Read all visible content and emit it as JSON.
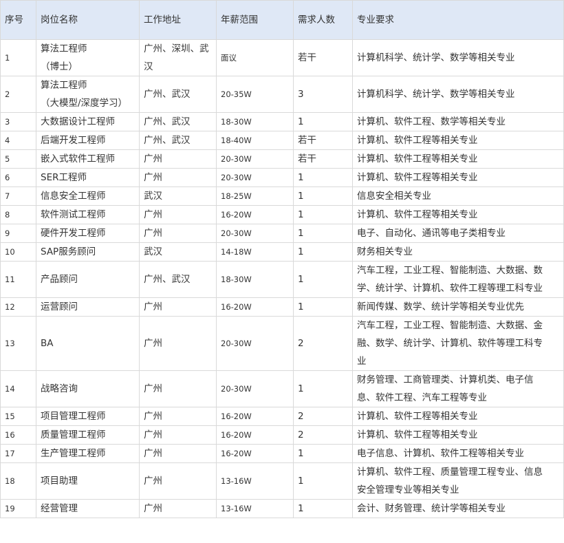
{
  "table": {
    "headers": [
      "序号",
      "岗位名称",
      "工作地址",
      "年薪范围",
      "需求人数",
      "专业要求"
    ],
    "rows": [
      {
        "no": "1",
        "title_lines": [
          "算法工程师",
          "（博士）"
        ],
        "location_lines": [
          "广州、深圳、武",
          "汉"
        ],
        "salary": "面议",
        "count": "若干",
        "major_lines": [
          "计算机科学、统计学、数学等相关专业"
        ]
      },
      {
        "no": "2",
        "title_lines": [
          "算法工程师",
          "（大模型/深度学习）"
        ],
        "location_lines": [
          "广州、武汉"
        ],
        "salary": "20-35W",
        "count": "3",
        "major_lines": [
          "计算机科学、统计学、数学等相关专业"
        ]
      },
      {
        "no": "3",
        "title_lines": [
          "大数据设计工程师"
        ],
        "location_lines": [
          "广州、武汉"
        ],
        "salary": "18-30W",
        "count": "1",
        "major_lines": [
          "计算机、软件工程、数学等相关专业"
        ]
      },
      {
        "no": "4",
        "title_lines": [
          "后端开发工程师"
        ],
        "location_lines": [
          "广州、武汉"
        ],
        "salary": "18-40W",
        "count": "若干",
        "major_lines": [
          "计算机、软件工程等相关专业"
        ]
      },
      {
        "no": "5",
        "title_lines": [
          "嵌入式软件工程师"
        ],
        "location_lines": [
          "广州"
        ],
        "salary": "20-30W",
        "count": "若干",
        "major_lines": [
          "计算机、软件工程等相关专业"
        ]
      },
      {
        "no": "6",
        "title_lines": [
          "SER工程师"
        ],
        "location_lines": [
          "广州"
        ],
        "salary": "20-30W",
        "count": "1",
        "major_lines": [
          "计算机、软件工程等相关专业"
        ]
      },
      {
        "no": "7",
        "title_lines": [
          "信息安全工程师"
        ],
        "location_lines": [
          "武汉"
        ],
        "salary": "18-25W",
        "count": "1",
        "major_lines": [
          "信息安全相关专业"
        ]
      },
      {
        "no": "8",
        "title_lines": [
          "软件测试工程师"
        ],
        "location_lines": [
          "广州"
        ],
        "salary": "16-20W",
        "count": "1",
        "major_lines": [
          "计算机、软件工程等相关专业"
        ]
      },
      {
        "no": "9",
        "title_lines": [
          "硬件开发工程师"
        ],
        "location_lines": [
          "广州"
        ],
        "salary": "20-30W",
        "count": "1",
        "major_lines": [
          "电子、自动化、通讯等电子类相专业"
        ]
      },
      {
        "no": "10",
        "title_lines": [
          "SAP服务顾问"
        ],
        "location_lines": [
          "武汉"
        ],
        "salary": "14-18W",
        "count": "1",
        "major_lines": [
          "财务相关专业"
        ]
      },
      {
        "no": "11",
        "title_lines": [
          "产品顾问"
        ],
        "location_lines": [
          "广州、武汉"
        ],
        "salary": "18-30W",
        "count": "1",
        "major_lines": [
          "汽车工程，工业工程、智能制造、大数据、数",
          "学、统计学、计算机、软件工程等理工科专业"
        ]
      },
      {
        "no": "12",
        "title_lines": [
          "运营顾问"
        ],
        "location_lines": [
          "广州"
        ],
        "salary": "16-20W",
        "count": "1",
        "major_lines": [
          "新闻传媒、数学、统计学等相关专业优先"
        ]
      },
      {
        "no": "13",
        "title_lines": [
          "BA"
        ],
        "location_lines": [
          "广州"
        ],
        "salary": "20-30W",
        "count": "2",
        "major_lines": [
          "汽车工程，工业工程、智能制造、大数据、金",
          "融、数学、统计学、计算机、软件等理工科专",
          "业"
        ]
      },
      {
        "no": "14",
        "title_lines": [
          "战略咨询"
        ],
        "location_lines": [
          "广州"
        ],
        "salary": "20-30W",
        "count": "1",
        "major_lines": [
          "财务管理、工商管理类、计算机类、电子信",
          "息、软件工程、汽车工程等专业"
        ]
      },
      {
        "no": "15",
        "title_lines": [
          "项目管理工程师"
        ],
        "location_lines": [
          "广州"
        ],
        "salary": "16-20W",
        "count": "2",
        "major_lines": [
          "计算机、软件工程等相关专业"
        ]
      },
      {
        "no": "16",
        "title_lines": [
          "质量管理工程师"
        ],
        "location_lines": [
          "广州"
        ],
        "salary": "16-20W",
        "count": "2",
        "major_lines": [
          "计算机、软件工程等相关专业"
        ]
      },
      {
        "no": "17",
        "title_lines": [
          "生产管理工程师"
        ],
        "location_lines": [
          "广州"
        ],
        "salary": "16-20W",
        "count": "1",
        "major_lines": [
          "电子信息、计算机、软件工程等相关专业"
        ]
      },
      {
        "no": "18",
        "title_lines": [
          "项目助理"
        ],
        "location_lines": [
          "广州"
        ],
        "salary": "13-16W",
        "count": "1",
        "major_lines": [
          "计算机、软件工程、质量管理工程专业、信息",
          "安全管理专业等相关专业"
        ]
      },
      {
        "no": "19",
        "title_lines": [
          "经营管理"
        ],
        "location_lines": [
          "广州"
        ],
        "salary": "13-16W",
        "count": "1",
        "major_lines": [
          "会计、财务管理、统计学等相关专业"
        ]
      }
    ]
  }
}
